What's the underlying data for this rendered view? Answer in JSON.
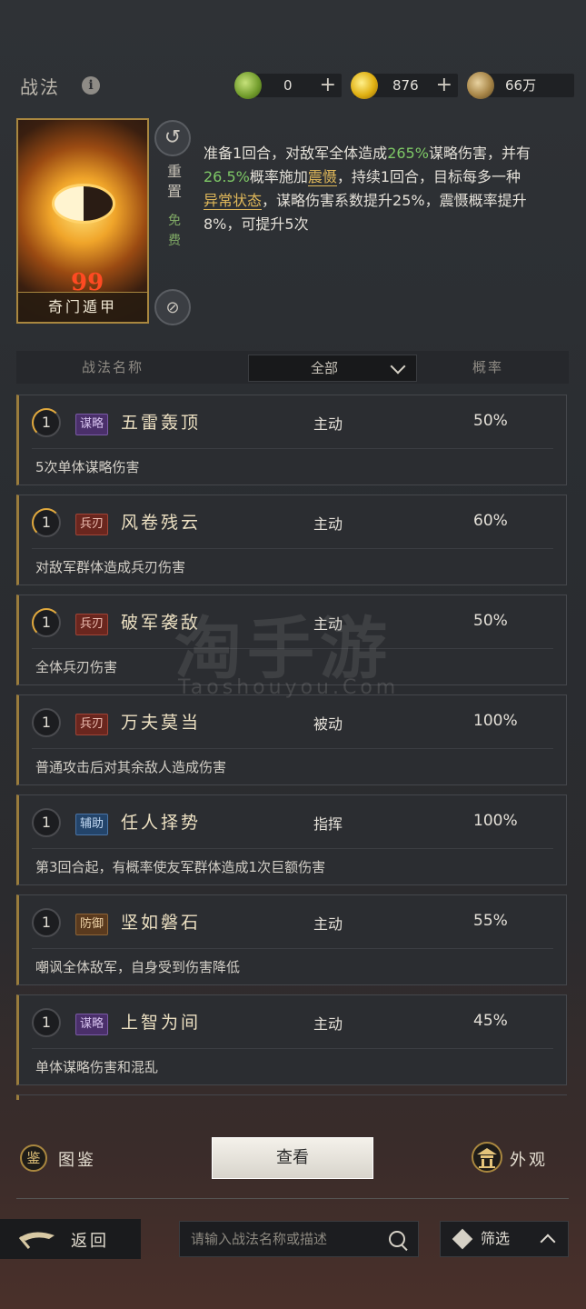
{
  "header": {
    "title": "战法",
    "info_icon": "i",
    "resources": [
      {
        "icon": "jade-coin-icon",
        "value": "0",
        "plus": "+"
      },
      {
        "icon": "gold-coin-icon",
        "value": "876",
        "plus": "+"
      },
      {
        "icon": "copper-coin-icon",
        "value": "66万"
      }
    ]
  },
  "skill": {
    "card_name": "奇门遁甲",
    "card_quote": "99",
    "reset_label": "重置",
    "free_label": "免费",
    "desc": {
      "p1": "准备1回合，对敌军全体造成",
      "pct1": "265%",
      "p2": "谋略伤害，并有",
      "pct2": "26.5%",
      "p3": "概率施加",
      "status1": "震慑",
      "p4": "，持续1回合，目标每多一种",
      "status2": "异常状态",
      "p5": "，谋略伤害系数提升25%，震慑概率提升8%，可提升5次"
    }
  },
  "table": {
    "col_name": "战法名称",
    "col_filter": "全部",
    "col_prob": "概率"
  },
  "skills": [
    {
      "level": "1",
      "tag": "谋略",
      "name": "五雷轰顶",
      "type": "主动",
      "prob": "50%",
      "desc": "5次单体谋略伤害"
    },
    {
      "level": "1",
      "tag": "兵刃",
      "name": "风卷残云",
      "type": "主动",
      "prob": "60%",
      "desc": "对敌军群体造成兵刃伤害"
    },
    {
      "level": "1",
      "tag": "兵刃",
      "name": "破军袭敌",
      "type": "主动",
      "prob": "50%",
      "desc": "全体兵刃伤害"
    },
    {
      "level": "1",
      "tag": "兵刃",
      "name": "万夫莫当",
      "type": "被动",
      "prob": "100%",
      "desc": "普通攻击后对其余敌人造成伤害"
    },
    {
      "level": "1",
      "tag": "辅助",
      "name": "任人择势",
      "type": "指挥",
      "prob": "100%",
      "desc": "第3回合起，有概率使友军群体造成1次巨额伤害"
    },
    {
      "level": "1",
      "tag": "防御",
      "name": "坚如磐石",
      "type": "主动",
      "prob": "55%",
      "desc": "嘲讽全体敌军，自身受到伤害降低"
    },
    {
      "level": "1",
      "tag": "谋略",
      "name": "上智为间",
      "type": "主动",
      "prob": "45%",
      "desc": "单体谋略伤害和混乱"
    }
  ],
  "watermark": {
    "cn": "淘手游",
    "en": "Taoshouyou.Com"
  },
  "bottom": {
    "atlas_icon": "鉴",
    "atlas_label": "图鉴",
    "view_label": "查看",
    "appearance_label": "外观",
    "back_label": "返回",
    "search_placeholder": "请输入战法名称或描述",
    "filter_label": "筛选"
  }
}
